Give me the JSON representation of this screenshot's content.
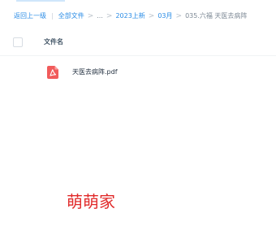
{
  "breadcrumb": {
    "back": "返回上一级",
    "separator_bar": "|",
    "all_files": "全部文件",
    "sep": ">",
    "ellipsis": "...",
    "crumb1": "2023上新",
    "crumb2": "03月",
    "current": "035.六福 天医去病阵"
  },
  "table": {
    "header_name": "文件名",
    "files": [
      {
        "name": "天医去病阵.pdf",
        "icon": "pdf-icon"
      }
    ]
  },
  "watermark": {
    "text": "萌萌家"
  },
  "colors": {
    "link": "#2a8ce6",
    "pdf_red": "#f15b5b",
    "watermark_red": "#e12b2b"
  }
}
